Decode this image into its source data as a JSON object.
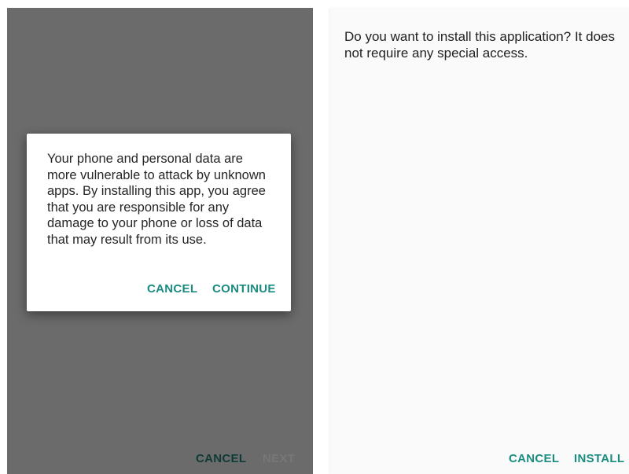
{
  "left_screen": {
    "dialog": {
      "message": "Your phone and personal data are more vulnerable to attack by unknown apps. By installing this app, you agree that you are responsible for any damage to your phone or loss of data that may result from its use.",
      "cancel_label": "CANCEL",
      "continue_label": "CONTINUE"
    },
    "bottom_bar": {
      "cancel_label": "CANCEL",
      "next_label": "NEXT"
    }
  },
  "right_screen": {
    "message": "Do you want to install this application? It does not require any special access.",
    "bottom_bar": {
      "cancel_label": "CANCEL",
      "install_label": "INSTALL"
    }
  },
  "colors": {
    "accent": "#1a8c7f",
    "scrim": "#6b6b6b",
    "dialog_background": "#ffffff",
    "screen_background": "#fafafa"
  }
}
